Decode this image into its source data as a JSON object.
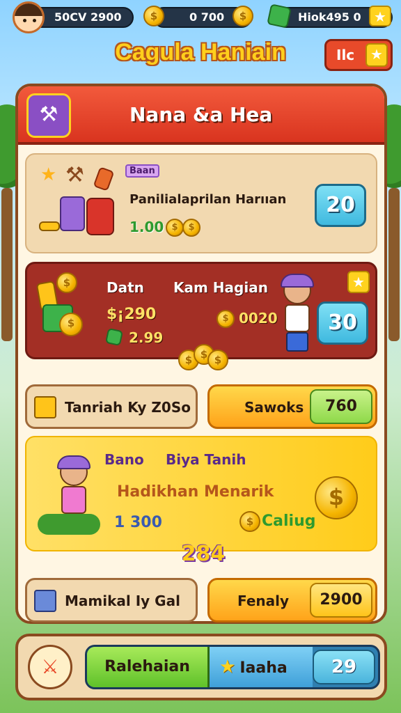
{
  "topbar": {
    "stat_left": "50CV 2900",
    "stat_mid": "0 700",
    "stat_right": "Hiok495 0"
  },
  "header": {
    "title": "Cagula Haniain",
    "right_label": "Ilc"
  },
  "panel": {
    "title": "Nana &a Hea",
    "card1": {
      "tag": "Baan",
      "name": "Panilialaprilan Harııan",
      "reward": "1.00",
      "value": "20"
    },
    "card2": {
      "label_left": "Datn",
      "label_right": "Kam Hagian",
      "amount": "$¡290",
      "gems": "2.99",
      "coins": "0020",
      "value": "30"
    },
    "row1": {
      "left_label": "Tanriah Ky Z0So",
      "right_label": "Sawoks",
      "right_value": "760"
    },
    "card3": {
      "label_left": "Bano",
      "label_right": "Biya Tanih",
      "subtitle": "Hadikhan Menarik",
      "amount": "1 300",
      "button": "Caliug"
    },
    "badge": "284",
    "row2": {
      "left_label": "Mamikal Iy Gal",
      "right_label": "Fenaly",
      "right_value": "2900"
    }
  },
  "bottombar": {
    "green_label": "Ralehaian",
    "blue_label": "Iaaha",
    "value": "29"
  },
  "colors": {
    "panel_header": "#e0402a",
    "accent_gold": "#ffcf1c",
    "panel_bg": "#fff6e3"
  }
}
